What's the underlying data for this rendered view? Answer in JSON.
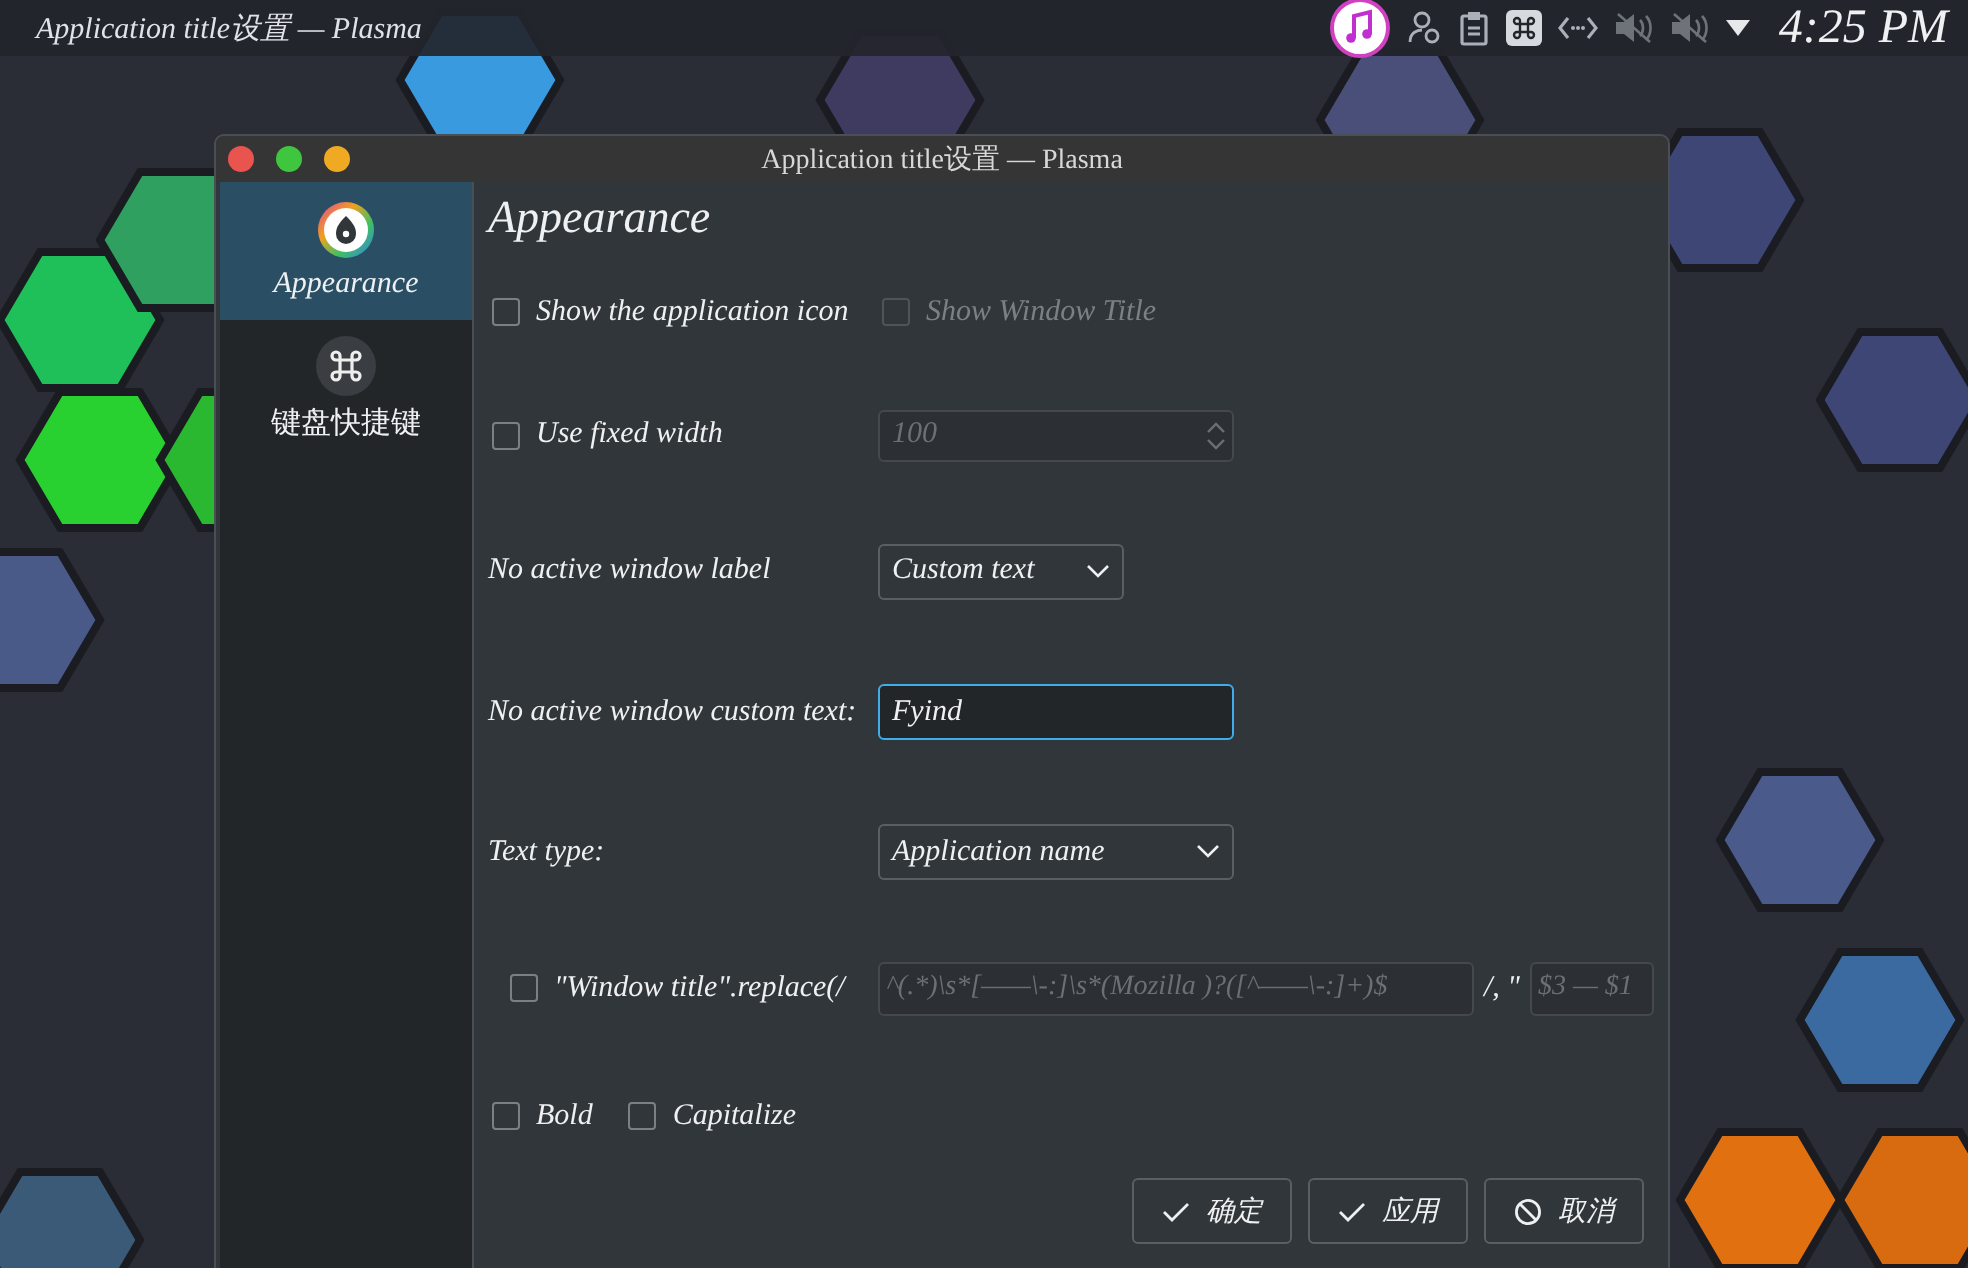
{
  "panel": {
    "window_title": "Application title设置 — Plasma",
    "clock": "4:25 PM"
  },
  "window": {
    "title": "Application title设置 — Plasma"
  },
  "sidebar": {
    "items": [
      {
        "label": "Appearance",
        "selected": true,
        "kind": "appearance"
      },
      {
        "label": "键盘快捷键",
        "selected": false,
        "kind": "shortcuts"
      }
    ]
  },
  "page_title": "Appearance",
  "show_icon": {
    "label": "Show the application icon",
    "checked": false
  },
  "show_title": {
    "label": "Show Window Title",
    "checked": false,
    "disabled": true
  },
  "fixed_width": {
    "label": "Use fixed width",
    "checked": false
  },
  "width_spinbox": {
    "value": "100",
    "disabled": true
  },
  "no_active_label": {
    "label": "No active window label",
    "value": "Custom text"
  },
  "custom_text": {
    "label": "No active window custom text:",
    "value": "Fyind"
  },
  "text_type": {
    "label": "Text type:",
    "value": "Application name"
  },
  "regex": {
    "checked": false,
    "label": "\"Window title\".replace(/",
    "pattern": "^(.*)\\s*[——\\-:]\\s*(Mozilla )?([^——\\-:]+)$",
    "separator": "/, \"",
    "replacement": "$3 — $1",
    "disabled": true
  },
  "style_options": [
    {
      "label": "Bold",
      "checked": false
    },
    {
      "label": "Capitalize",
      "checked": false
    }
  ],
  "buttons": [
    {
      "label": "确定",
      "kind": "ok"
    },
    {
      "label": "应用",
      "kind": "apply"
    },
    {
      "label": "取消",
      "kind": "cancel"
    }
  ]
}
